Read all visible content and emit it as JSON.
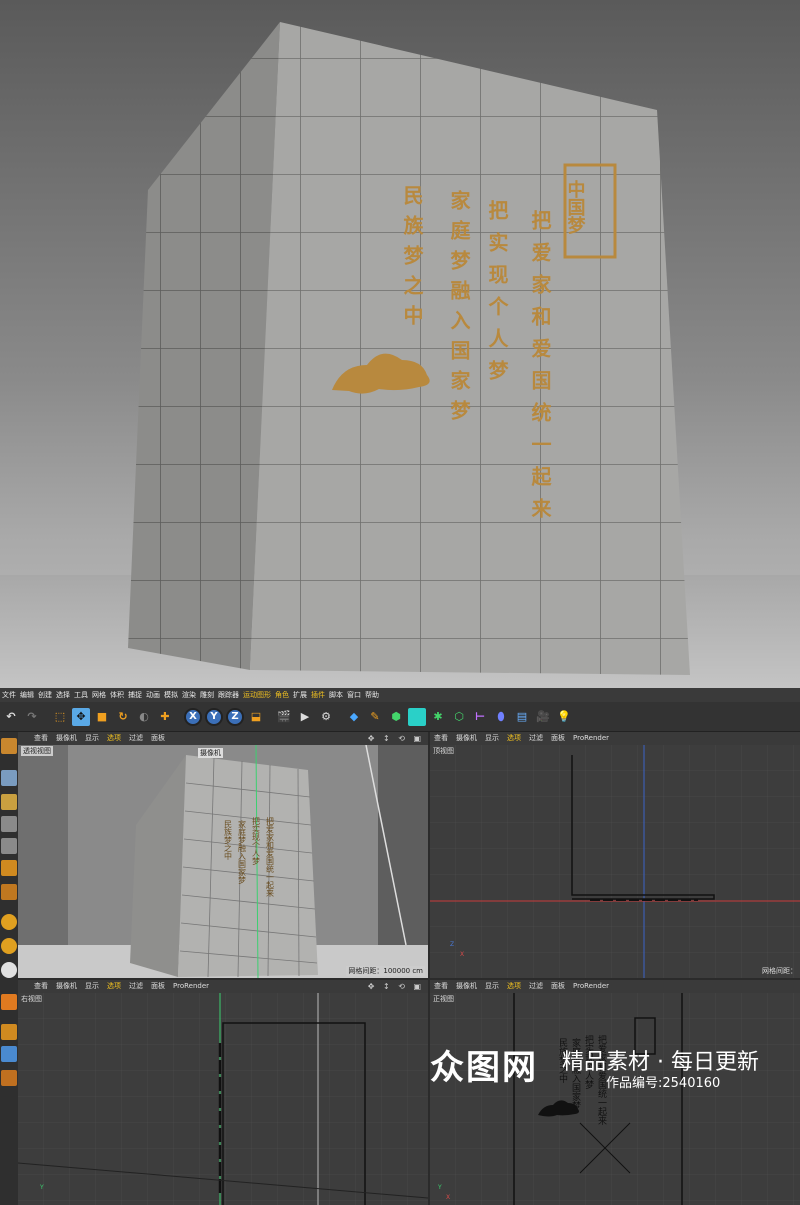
{
  "hero": {
    "sign": {
      "logo": "中国梦",
      "col1": "把爱家和爱国统一起来",
      "col2": "把实现个人梦",
      "col3": "家庭梦融入国家梦",
      "col4": "民族梦之中"
    }
  },
  "menu": [
    "文件",
    "编辑",
    "创建",
    "选择",
    "工具",
    "网格",
    "体积",
    "捕捉",
    "动画",
    "模拟",
    "渲染",
    "雕刻",
    "跟踪器",
    "运动图形",
    "角色",
    "扩展",
    "插件",
    "脚本",
    "窗口",
    "帮助"
  ],
  "toolbar": {
    "axes": [
      "X",
      "Y",
      "Z"
    ]
  },
  "viewports": {
    "header_menu": [
      "查看",
      "摄像机",
      "显示",
      "选项",
      "过滤",
      "面板",
      "ProRender"
    ],
    "selected_menu": "选项",
    "controls": "✥ ↕ ⟲ ▣",
    "perspective": {
      "title": "透视视图",
      "camera": "摄像机",
      "grid": "网格间距：100000 cm"
    },
    "top": {
      "title": "顶视图",
      "grid": "网格间距："
    },
    "right": {
      "title": "右视图"
    },
    "front": {
      "title": "正视图"
    }
  },
  "watermark": {
    "brand": "众图网",
    "tagline": "精品素材 · 每日更新",
    "code": "作品编号:2540160"
  }
}
